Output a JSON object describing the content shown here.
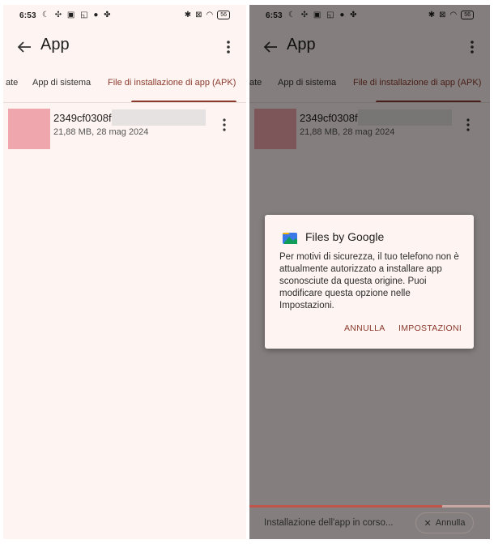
{
  "status_bar": {
    "time": "6:53",
    "left_icons": [
      "moon-icon",
      "fan-icon",
      "image-icon",
      "cast-icon",
      "facebook-icon",
      "settings-icon"
    ],
    "right_icons": [
      "bluetooth-icon",
      "mute-icon",
      "wifi-icon"
    ],
    "battery": "56"
  },
  "app_bar": {
    "title": "App"
  },
  "tabs": [
    {
      "label": "ate"
    },
    {
      "label": "App di sistema"
    },
    {
      "label": "File di installazione di app (APK)",
      "active": true
    }
  ],
  "file": {
    "name": "2349cf0308fl",
    "meta": "21,88 MB, 28 mag 2024"
  },
  "dialog": {
    "title": "Files by Google",
    "body": "Per motivi di sicurezza, il tuo telefono non è attualmente autorizzato a installare app sconosciute da questa origine. Puoi modificare questa opzione nelle Impostazioni.",
    "cancel_label": "ANNULLA",
    "settings_label": "IMPOSTAZIONI"
  },
  "install_bar": {
    "status": "Installazione dell'app in corso...",
    "cancel_label": "Annulla",
    "progress": 0.8
  },
  "colors": {
    "accent": "#8b3a2e",
    "background": "#fef4f1",
    "thumbnail": "#f0a6ad"
  }
}
